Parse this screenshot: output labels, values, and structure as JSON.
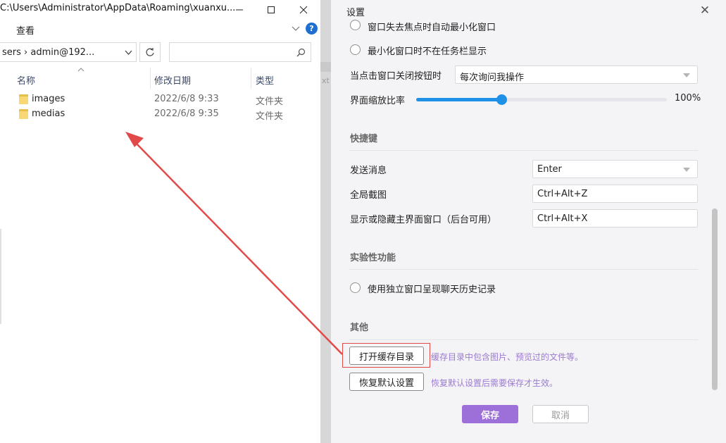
{
  "explorer": {
    "title_path": "C:\\Users\\Administrator\\AppData\\Roaming\\xuanxu...",
    "ribbon_view": "查看",
    "address_text": "sers  ›  admin@192...",
    "columns": {
      "name": "名称",
      "date": "修改日期",
      "type": "类型"
    },
    "rows": [
      {
        "name": "images",
        "date": "2022/6/8 9:33",
        "type": "文件夹"
      },
      {
        "name": "medias",
        "date": "2022/6/8 9:35",
        "type": "文件夹"
      }
    ]
  },
  "gap": {
    "ghost_text": "xt"
  },
  "settings": {
    "title": "设置",
    "partial_option": "窗口失去焦点时自动最小化窗口",
    "minimize_option": "最小化窗口时不在任务栏显示",
    "close_behavior_label": "当点击窗口关闭按钮时",
    "close_behavior_value": "每次询问我操作",
    "zoom_label": "界面缩放比率",
    "zoom_value": "100%",
    "zoom_fraction": 0.34,
    "shortcuts_section": "快捷键",
    "send_label": "发送消息",
    "send_value": "Enter",
    "screenshot_label": "全局截图",
    "screenshot_value": "Ctrl+Alt+Z",
    "toggle_label": "显示或隐藏主界面窗口（后台可用）",
    "toggle_value": "Ctrl+Alt+X",
    "experimental_section": "实验性功能",
    "independent_window_option": "使用独立窗口呈现聊天历史记录",
    "other_section": "其他",
    "open_cache_button": "打开缓存目录",
    "open_cache_hint": "缓存目录中包含图片、预览过的文件等。",
    "restore_button": "恢复默认设置",
    "restore_hint": "恢复默认设置后需要保存才生效。",
    "save_button": "保存",
    "cancel_button": "取消"
  },
  "colors": {
    "accent": "#9d6fd8",
    "slider": "#1e90e6",
    "annotation": "#e24a4a"
  }
}
